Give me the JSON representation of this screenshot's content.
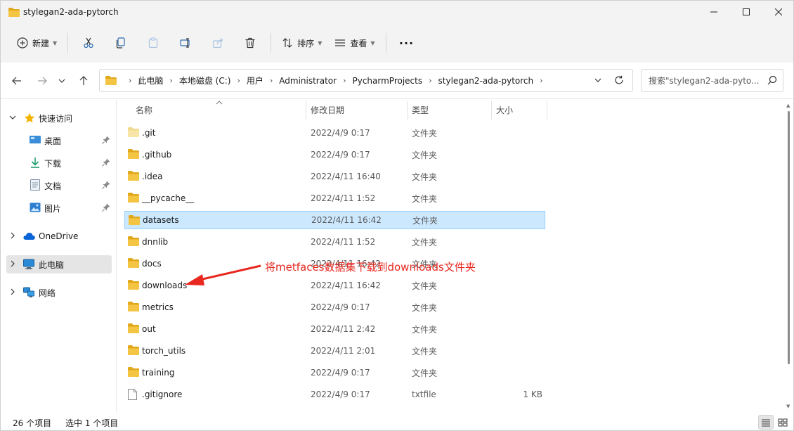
{
  "window": {
    "title": "stylegan2-ada-pytorch",
    "minimize_glyph": "—",
    "maximize_glyph": "☐",
    "close_glyph": "✕"
  },
  "toolbar": {
    "new_label": "新建",
    "sort_label": "排序",
    "view_label": "查看",
    "more_glyph": "···"
  },
  "address": {
    "crumbs": [
      "此电脑",
      "本地磁盘 (C:)",
      "用户",
      "Administrator",
      "PycharmProjects",
      "stylegan2-ada-pytorch"
    ],
    "search_placeholder": "搜索\"stylegan2-ada-pyto..."
  },
  "sidebar": {
    "quick_access": "快速访问",
    "items": [
      {
        "label": "桌面"
      },
      {
        "label": "下载"
      },
      {
        "label": "文档"
      },
      {
        "label": "图片"
      }
    ],
    "onedrive": "OneDrive",
    "this_pc": "此电脑",
    "network": "网络"
  },
  "columns": {
    "name": "名称",
    "date": "修改日期",
    "type": "类型",
    "size": "大小"
  },
  "files": [
    {
      "name": ".git",
      "date": "2022/4/9 0:17",
      "type": "文件夹",
      "size": "",
      "kind": "folder-light"
    },
    {
      "name": ".github",
      "date": "2022/4/9 0:17",
      "type": "文件夹",
      "size": "",
      "kind": "folder"
    },
    {
      "name": ".idea",
      "date": "2022/4/11 16:40",
      "type": "文件夹",
      "size": "",
      "kind": "folder"
    },
    {
      "name": "__pycache__",
      "date": "2022/4/11 1:52",
      "type": "文件夹",
      "size": "",
      "kind": "folder"
    },
    {
      "name": "datasets",
      "date": "2022/4/11 16:42",
      "type": "文件夹",
      "size": "",
      "kind": "folder",
      "selected": true
    },
    {
      "name": "dnnlib",
      "date": "2022/4/11 1:52",
      "type": "文件夹",
      "size": "",
      "kind": "folder"
    },
    {
      "name": "docs",
      "date": "2022/4/11 16:42",
      "type": "文件夹",
      "size": "",
      "kind": "folder"
    },
    {
      "name": "downloads",
      "date": "2022/4/11 16:42",
      "type": "文件夹",
      "size": "",
      "kind": "folder"
    },
    {
      "name": "metrics",
      "date": "2022/4/9 0:17",
      "type": "文件夹",
      "size": "",
      "kind": "folder"
    },
    {
      "name": "out",
      "date": "2022/4/11 2:42",
      "type": "文件夹",
      "size": "",
      "kind": "folder"
    },
    {
      "name": "torch_utils",
      "date": "2022/4/11 2:01",
      "type": "文件夹",
      "size": "",
      "kind": "folder"
    },
    {
      "name": "training",
      "date": "2022/4/9 0:17",
      "type": "文件夹",
      "size": "",
      "kind": "folder"
    },
    {
      "name": ".gitignore",
      "date": "2022/4/9 0:17",
      "type": "txtfile",
      "size": "1 KB",
      "kind": "file"
    }
  ],
  "status": {
    "count": "26 个项目",
    "selection": "选中 1 个项目"
  },
  "annotation": {
    "text": "将metfaces数据集下载到downloads文件夹",
    "color": "#e8271f"
  },
  "colors": {
    "folder": "#f4c542",
    "folder_dark": "#e2a81c",
    "selected_row": "#cce8ff",
    "accent": "#0067c0"
  }
}
